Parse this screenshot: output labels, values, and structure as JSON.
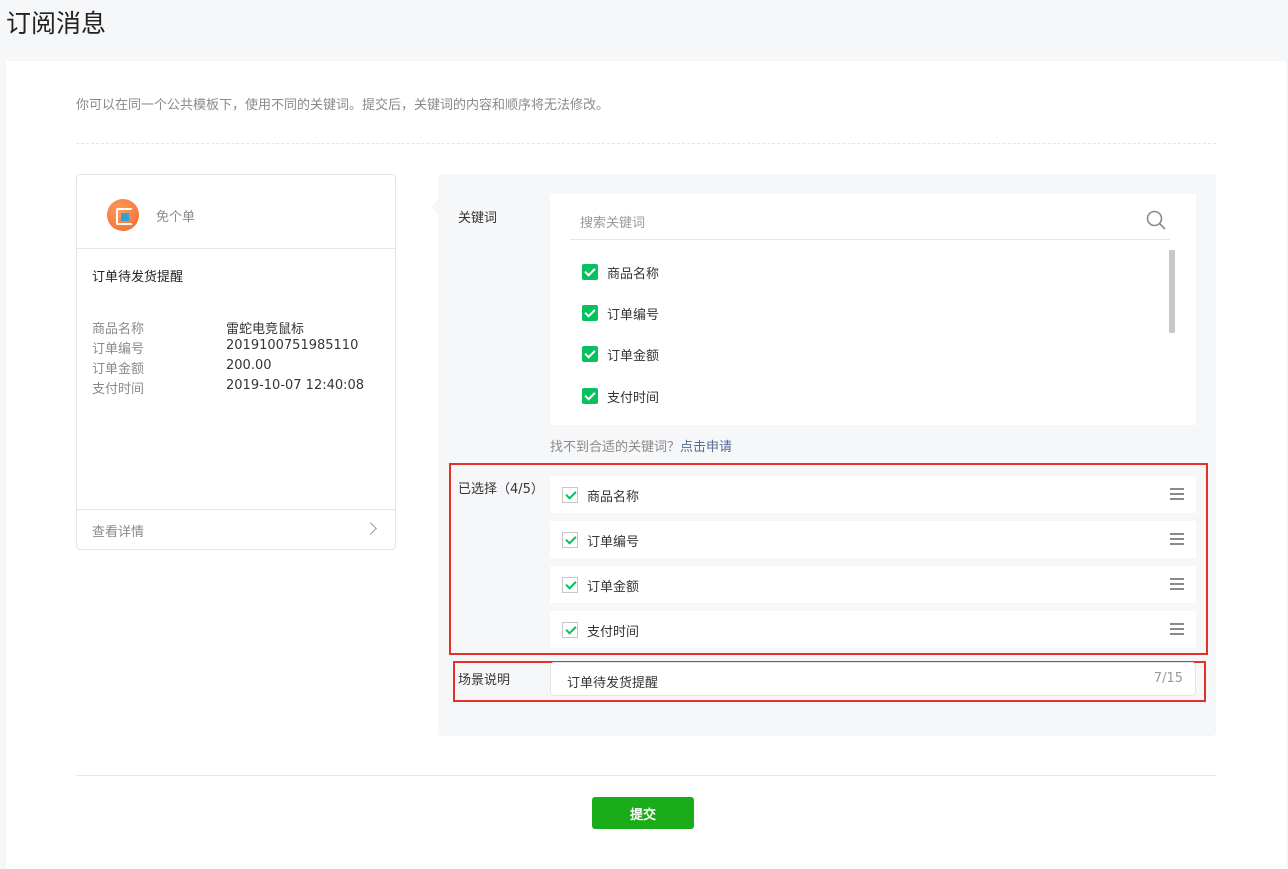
{
  "page": {
    "title": "订阅消息"
  },
  "tip": "你可以在同一个公共模板下，使用不同的关键词。提交后，关键词的内容和顺序将无法修改。",
  "preview": {
    "app_name": "免个单",
    "message_title": "订单待发货提醒",
    "fields": [
      {
        "key": "商品名称",
        "value": "雷蛇电竞鼠标"
      },
      {
        "key": "订单编号",
        "value": "2019100751985110"
      },
      {
        "key": "订单金额",
        "value": "200.00"
      },
      {
        "key": "支付时间",
        "value": "2019-10-07 12:40:08"
      }
    ],
    "detail_label": "查看详情"
  },
  "keywords": {
    "label": "关键词",
    "search_placeholder": "搜索关键词",
    "items": [
      "商品名称",
      "订单编号",
      "订单金额",
      "支付时间"
    ],
    "not_found_text": "找不到合适的关键词？",
    "apply_link": "点击申请"
  },
  "selected": {
    "label": "已选择（4/5）",
    "items": [
      "商品名称",
      "订单编号",
      "订单金额",
      "支付时间"
    ]
  },
  "scene": {
    "label": "场景说明",
    "value": "订单待发货提醒",
    "counter": "7/15"
  },
  "submit_label": "提交",
  "colors": {
    "accent_green": "#07c160",
    "button_green": "#1aad19",
    "highlight_red": "#e5302a",
    "link_blue": "#576b95"
  }
}
